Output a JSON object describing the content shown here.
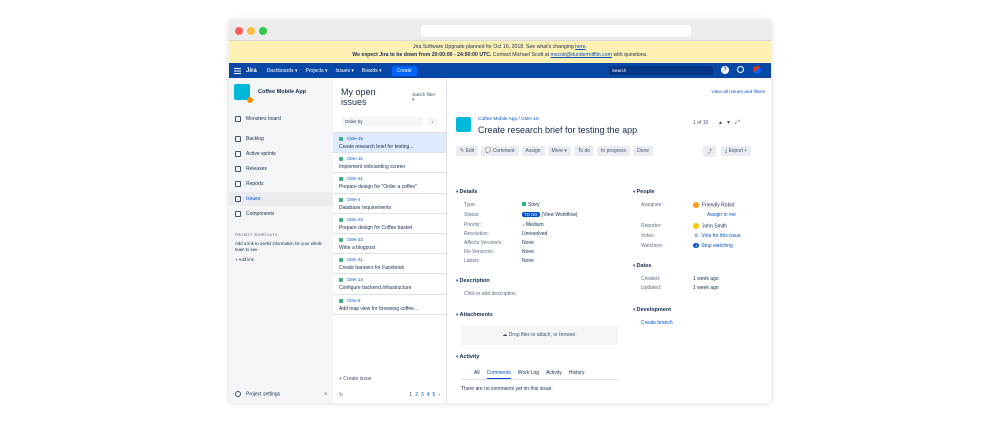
{
  "banner": {
    "line1": "Jira Software Upgrade planned for Oct 16, 2018. See what's changing ",
    "line1_link": "here",
    "line1_end": ".",
    "line2_bold": "We expect Jira to be down from 20:00:00 - 24:00:00 UTC.",
    "line2": " Contact Michael Scott at ",
    "line2_link": "mscott@dundermifflin.com",
    "line2_end": " with questions."
  },
  "nav": {
    "logo": "Jira",
    "menus": [
      "Dashboards ▾",
      "Projects ▾",
      "Issues ▾",
      "Boards ▾"
    ],
    "create": "Create",
    "search_placeholder": "Search",
    "help": "?"
  },
  "sidebar": {
    "project_name": "Coffee Mobile App",
    "board": "Monsters board",
    "items": [
      "Backlog",
      "Active sprints",
      "Releases",
      "Reports",
      "Issues",
      "Components"
    ],
    "shortcuts_title": "PROJECT SHORTCUTS",
    "shortcuts_note": "Add a link to useful information for your whole team to see.",
    "add_link": "+ Add link",
    "settings": "Project settings",
    "collapse": "«"
  },
  "list": {
    "title": "My open issues",
    "switch_filter": "Switch filter ▾",
    "order_by": "Order by",
    "order_icon": "↓",
    "issues": [
      {
        "key": "CMA-15",
        "title": "Create research brief for testing..."
      },
      {
        "key": "CMA-16",
        "title": "Implement onboarding screen"
      },
      {
        "key": "CMA-21",
        "title": "Prepare design for \"Order a coffee\""
      },
      {
        "key": "CMA-4",
        "title": "Database requirements"
      },
      {
        "key": "CMA-23",
        "title": "Prepare design for Coffee basket"
      },
      {
        "key": "CMA-33",
        "title": "Write a blogpost"
      },
      {
        "key": "CMA-31",
        "title": "Create banners for Facebook"
      },
      {
        "key": "CMA-14",
        "title": "Configure backend infrastructure"
      },
      {
        "key": "CMA-5",
        "title": "Add map view for browsing coffee..."
      }
    ],
    "create_issue": "+ Create issue",
    "refresh": "↻",
    "pages": [
      "1",
      "2",
      "3",
      "4",
      "5",
      "›"
    ]
  },
  "detail": {
    "view_all": "View all issues and filters",
    "breadcrumb": "Coffee Mobile App / CMA-15",
    "title": "Create research brief for testing the app",
    "position": "1 of 15",
    "toolbar": [
      "✎ Edit",
      "💬 Comment",
      "Assign",
      "More ▾",
      "To do",
      "In progress",
      "Done"
    ],
    "share": "⤴",
    "export": "⤓ Export ▾",
    "details_title": "Details",
    "details": [
      {
        "label": "Type:",
        "value": "Story"
      },
      {
        "label": "Status:",
        "badge": "TO DO",
        "value": "(View Workflow)"
      },
      {
        "label": "Priority:",
        "value": "↓ Medium"
      },
      {
        "label": "Resolution:",
        "value": "Unresolved"
      },
      {
        "label": "Affects Version/s:",
        "value": "None"
      },
      {
        "label": "Fix Version/s:",
        "value": "None"
      },
      {
        "label": "Labels:",
        "value": "None"
      }
    ],
    "description_title": "Description",
    "description_placeholder": "Click to add description",
    "attachments_title": "Attachments",
    "drop_text": "☁ Drop files to attach, or browse.",
    "activity_title": "Activity",
    "activity_tabs": [
      "All",
      "Comments",
      "Work Log",
      "Activity",
      "History"
    ],
    "no_comments": "There are no comments yet on this issue.",
    "people_title": "People",
    "assignee_label": "Assignee:",
    "assignee": "Friendly Robot",
    "assign_to_me": "Assign to me",
    "reporter_label": "Reporter:",
    "reporter": "John Smith",
    "votes_label": "Votes:",
    "votes": "Vote for this issue",
    "watchers_label": "Watchers:",
    "watchers": "Stop watching",
    "watchers_count": "1",
    "votes_count": "0",
    "dates_title": "Dates",
    "created_label": "Created:",
    "created": "1 week ago",
    "updated_label": "Updated:",
    "updated": "1 week ago",
    "development_title": "Development",
    "create_branch": "Create branch"
  }
}
